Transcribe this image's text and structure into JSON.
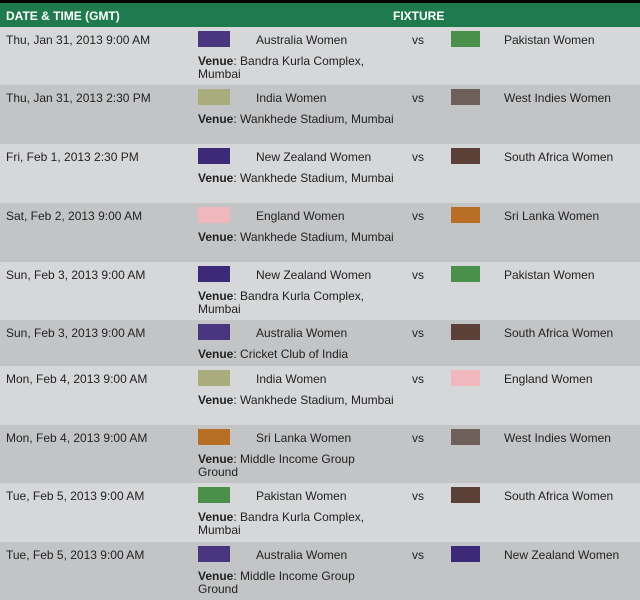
{
  "header": {
    "date_col": "DATE & TIME (GMT)",
    "fixture_col": "FIXTURE"
  },
  "venue_label": "Venue",
  "vs": "vs",
  "team_colors": {
    "Australia Women": "#4a3580",
    "Pakistan Women": "#4a8f4a",
    "India Women": "#a9ad7e",
    "West Indies Women": "#6e5f5a",
    "New Zealand Women": "#3c2a78",
    "South Africa Women": "#5c4038",
    "England Women": "#f0b8bd",
    "Sri Lanka Women": "#b86e25"
  },
  "fixtures": [
    {
      "date": "Thu, Jan 31, 2013 9:00 AM",
      "team1": "Australia Women",
      "team2": "Pakistan Women",
      "venue": "Bandra Kurla Complex, Mumbai"
    },
    {
      "date": "Thu, Jan 31, 2013 2:30 PM",
      "team1": "India Women",
      "team2": "West Indies Women",
      "venue": "Wankhede Stadium, Mumbai"
    },
    {
      "date": "Fri, Feb 1, 2013 2:30 PM",
      "team1": "New Zealand Women",
      "team2": "South Africa Women",
      "venue": "Wankhede Stadium, Mumbai"
    },
    {
      "date": "Sat, Feb 2, 2013 9:00 AM",
      "team1": "England Women",
      "team2": "Sri Lanka Women",
      "venue": "Wankhede Stadium, Mumbai"
    },
    {
      "date": "Sun, Feb 3, 2013 9:00 AM",
      "team1": "New Zealand Women",
      "team2": "Pakistan Women",
      "venue": "Bandra Kurla Complex, Mumbai"
    },
    {
      "date": "Sun, Feb 3, 2013 9:00 AM",
      "team1": "Australia Women",
      "team2": "South Africa Women",
      "venue": "Cricket Club of India"
    },
    {
      "date": "Mon, Feb 4, 2013 9:00 AM",
      "team1": "India Women",
      "team2": "England Women",
      "venue": "Wankhede Stadium, Mumbai"
    },
    {
      "date": "Mon, Feb 4, 2013 9:00 AM",
      "team1": "Sri Lanka Women",
      "team2": "West Indies Women",
      "venue": "Middle Income Group Ground"
    },
    {
      "date": "Tue, Feb 5, 2013 9:00 AM",
      "team1": "Pakistan Women",
      "team2": "South Africa Women",
      "venue": "Bandra Kurla Complex, Mumbai"
    },
    {
      "date": "Tue, Feb 5, 2013 9:00 AM",
      "team1": "Australia Women",
      "team2": "New Zealand Women",
      "venue": "Middle Income Group Ground"
    }
  ]
}
